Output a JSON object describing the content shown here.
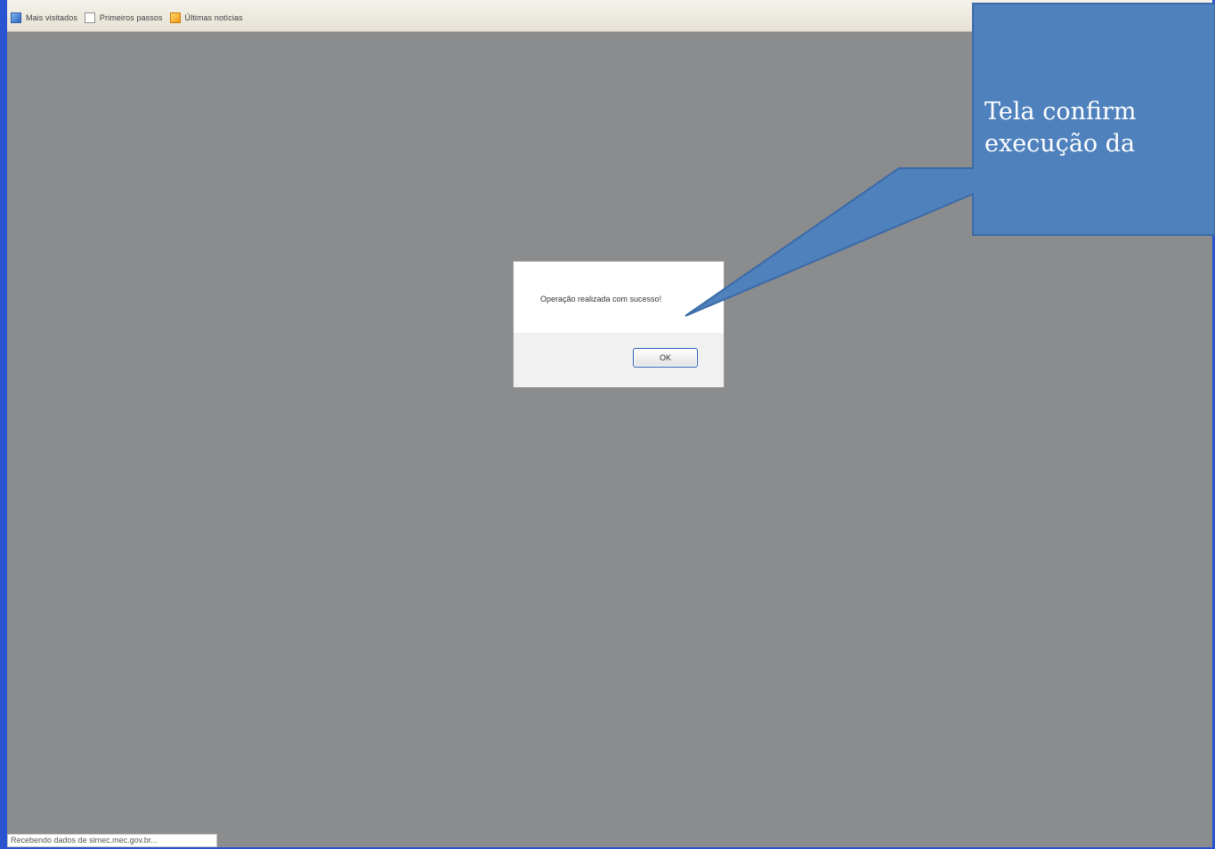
{
  "bookmarks": [
    {
      "label": "Mais visitados",
      "icon": "most-visited-icon"
    },
    {
      "label": "Primeiros passos",
      "icon": "page-icon"
    },
    {
      "label": "Últimas notícias",
      "icon": "rss-icon"
    }
  ],
  "dialog": {
    "message": "Operação realizada com sucesso!",
    "ok_label": "OK"
  },
  "status_bar": {
    "text": "Recebendo dados de simec.mec.gov.br..."
  },
  "callout": {
    "line1": "Tela confirm",
    "line2": "execução da",
    "fill_color": "#4f81bd",
    "border_color": "#3a6aa8"
  },
  "colors": {
    "window_border": "#2a54cf",
    "overlay": "#8b8c8d"
  }
}
